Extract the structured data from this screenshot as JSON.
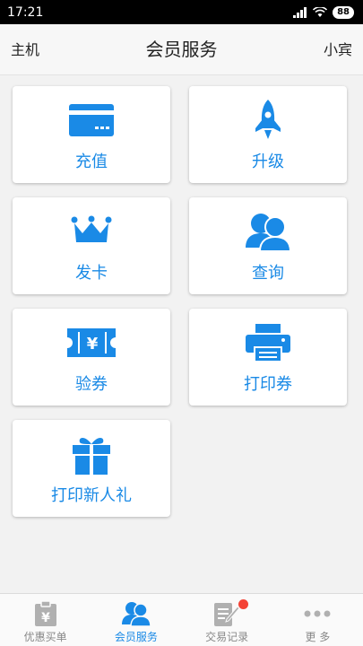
{
  "status": {
    "time": "17:21",
    "signal": "4G",
    "battery": "88"
  },
  "header": {
    "left": "主机",
    "title": "会员服务",
    "right": "小宾"
  },
  "tiles": [
    {
      "label": "充值",
      "icon": "card-icon"
    },
    {
      "label": "升级",
      "icon": "rocket-icon"
    },
    {
      "label": "发卡",
      "icon": "crown-icon"
    },
    {
      "label": "查询",
      "icon": "users-icon"
    },
    {
      "label": "验券",
      "icon": "ticket-icon"
    },
    {
      "label": "打印券",
      "icon": "printer-icon"
    },
    {
      "label": "打印新人礼",
      "icon": "gift-icon"
    }
  ],
  "tabs": [
    {
      "label": "优惠买单",
      "icon": "receipt-icon",
      "active": false
    },
    {
      "label": "会员服务",
      "icon": "members-icon",
      "active": true
    },
    {
      "label": "交易记录",
      "icon": "edit-doc-icon",
      "active": false,
      "badge": true
    },
    {
      "label": "更 多",
      "icon": "more-icon",
      "active": false
    }
  ],
  "colors": {
    "accent": "#1a8ae6",
    "badge": "#f44336",
    "inactive": "#b0b0b0"
  }
}
